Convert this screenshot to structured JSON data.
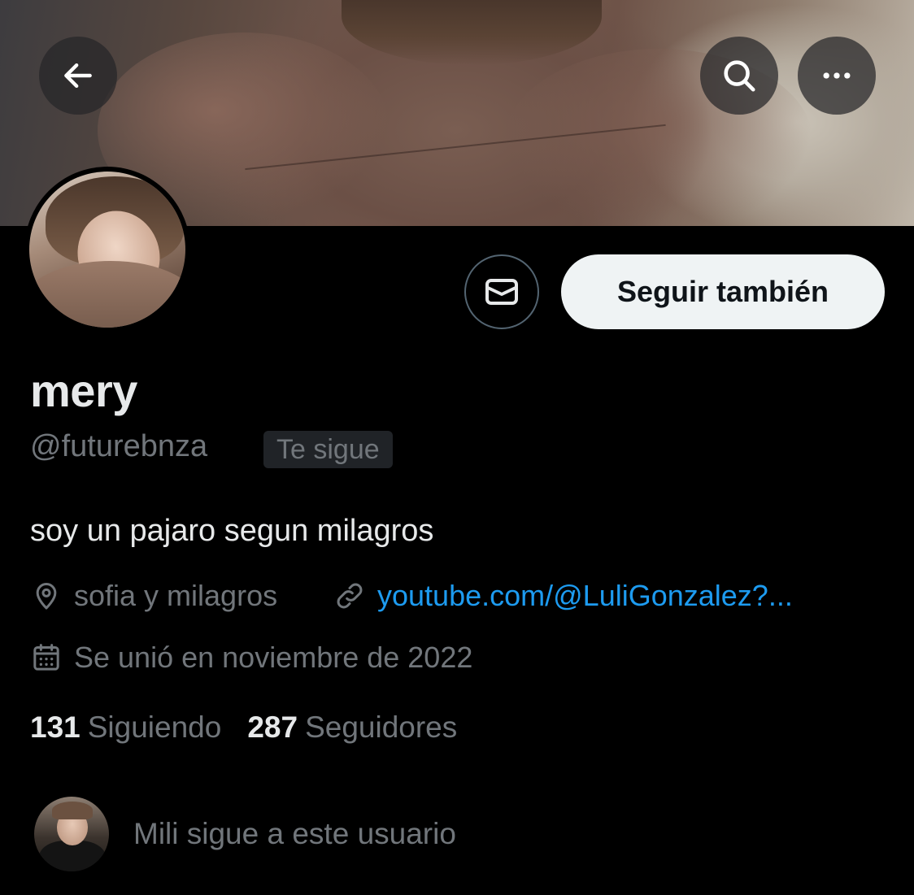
{
  "header": {
    "back_icon": "arrow-left-icon",
    "search_icon": "search-icon",
    "more_icon": "more-horizontal-icon"
  },
  "profile": {
    "name": "mery",
    "handle": "@futurebnza",
    "follows_you_badge": "Te sigue",
    "bio": "soy un pajaro segun milagros",
    "location": "sofia y milagros",
    "website": "youtube.com/@LuliGonzalez?...",
    "joined": "Se unió en noviembre de 2022"
  },
  "actions": {
    "message_icon": "envelope-icon",
    "follow_label": "Seguir también"
  },
  "stats": {
    "following_count": "131",
    "following_label": "Siguiendo",
    "followers_count": "287",
    "followers_label": "Seguidores"
  },
  "mutual": {
    "text": "Mili sigue a este usuario"
  },
  "colors": {
    "background": "#000000",
    "primary_text": "#e7e9ea",
    "secondary_text": "#71767b",
    "link": "#1d9bf0",
    "follow_button_bg": "#eff3f4",
    "border": "#536471"
  }
}
